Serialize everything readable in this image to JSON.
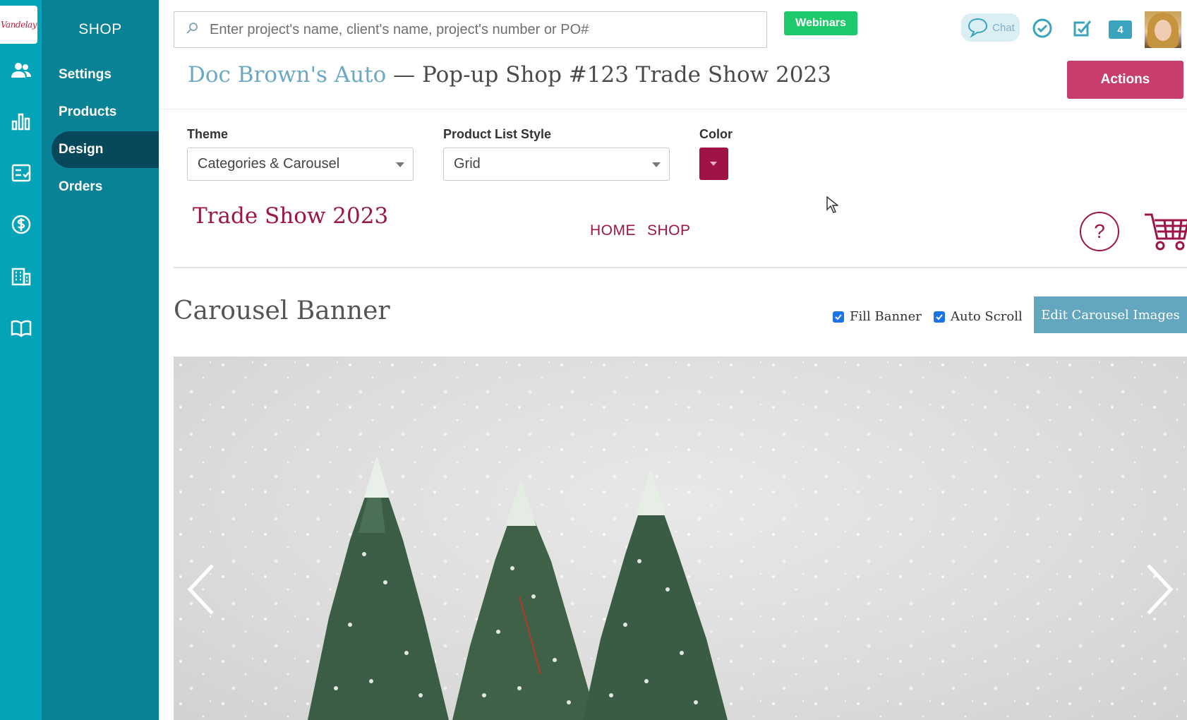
{
  "brand": {
    "logo_text": "Vandelay",
    "accent": "#05a3b7",
    "subnav_bg": "#0a8295",
    "store_color": "#9c1548"
  },
  "rail": {
    "icons": [
      "users-icon",
      "bar-chart-icon",
      "checklist-icon",
      "dollar-icon",
      "building-icon",
      "book-icon"
    ]
  },
  "subnav": {
    "title": "SHOP",
    "items": [
      {
        "label": "Settings",
        "active": false
      },
      {
        "label": "Products",
        "active": false
      },
      {
        "label": "Design",
        "active": true
      },
      {
        "label": "Orders",
        "active": false
      }
    ]
  },
  "topbar": {
    "search_placeholder": "Enter project's name, client's name, project's number or PO#",
    "webinars_label": "Webinars",
    "chat_label": "Chat",
    "notification_count": "4"
  },
  "header": {
    "client_name": "Doc Brown's Auto",
    "separator": " — ",
    "project_name": "Pop-up Shop #123 Trade Show 2023",
    "actions_label": "Actions"
  },
  "design_form": {
    "theme_label": "Theme",
    "theme_value": "Categories & Carousel",
    "list_style_label": "Product List Style",
    "list_style_value": "Grid",
    "color_label": "Color",
    "color_value": "#a01347"
  },
  "store_preview": {
    "title": "Trade Show 2023",
    "nav": [
      "HOME",
      "SHOP"
    ],
    "help_symbol": "?"
  },
  "carousel": {
    "title": "Carousel Banner",
    "fill_banner_label": "Fill Banner",
    "fill_banner_checked": true,
    "auto_scroll_label": "Auto Scroll",
    "auto_scroll_checked": true,
    "edit_label": "Edit Carousel Images"
  }
}
